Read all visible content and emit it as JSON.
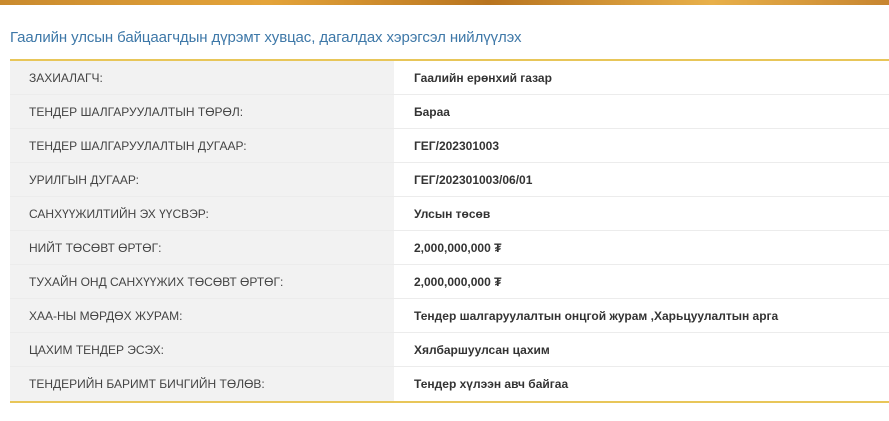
{
  "colors": {
    "title": "#3e78a8",
    "accent_border": "#e8c659",
    "label_bg": "#f2f2f2"
  },
  "page": {
    "title": "Гаалийн улсын байцаагчдын дүрэмт хувцас, дагалдах хэрэгсэл нийлүүлэх"
  },
  "details": {
    "rows": [
      {
        "label": "ЗАХИАЛАГЧ:",
        "value": "Гаалийн ерөнхий газар"
      },
      {
        "label": "ТЕНДЕР ШАЛГАРУУЛАЛТЫН ТӨРӨЛ:",
        "value": "Бараа"
      },
      {
        "label": "ТЕНДЕР ШАЛГАРУУЛАЛТЫН ДУГААР:",
        "value": "ГЕГ/202301003"
      },
      {
        "label": "УРИЛГЫН ДУГААР:",
        "value": "ГЕГ/202301003/06/01"
      },
      {
        "label": "САНХҮҮЖИЛТИЙН ЭХ ҮҮСВЭР:",
        "value": "Улсын төсөв"
      },
      {
        "label": "НИЙТ ТӨСӨВТ ӨРТӨГ:",
        "value": "2,000,000,000 ₮"
      },
      {
        "label": "ТУХАЙН ОНД САНХҮҮЖИХ ТӨСӨВТ ӨРТӨГ:",
        "value": "2,000,000,000 ₮"
      },
      {
        "label": "ХАА-НЫ МӨРДӨХ ЖУРАМ:",
        "value": "Тендер шалгаруулалтын онцгой журам ,Харьцуулалтын арга"
      },
      {
        "label": "ЦАХИМ ТЕНДЕР ЭСЭХ:",
        "value": "Хялбаршуулсан цахим"
      },
      {
        "label": "ТЕНДЕРИЙН БАРИМТ БИЧГИЙН ТӨЛӨВ:",
        "value": "Тендер хүлээн авч байгаа"
      }
    ]
  }
}
